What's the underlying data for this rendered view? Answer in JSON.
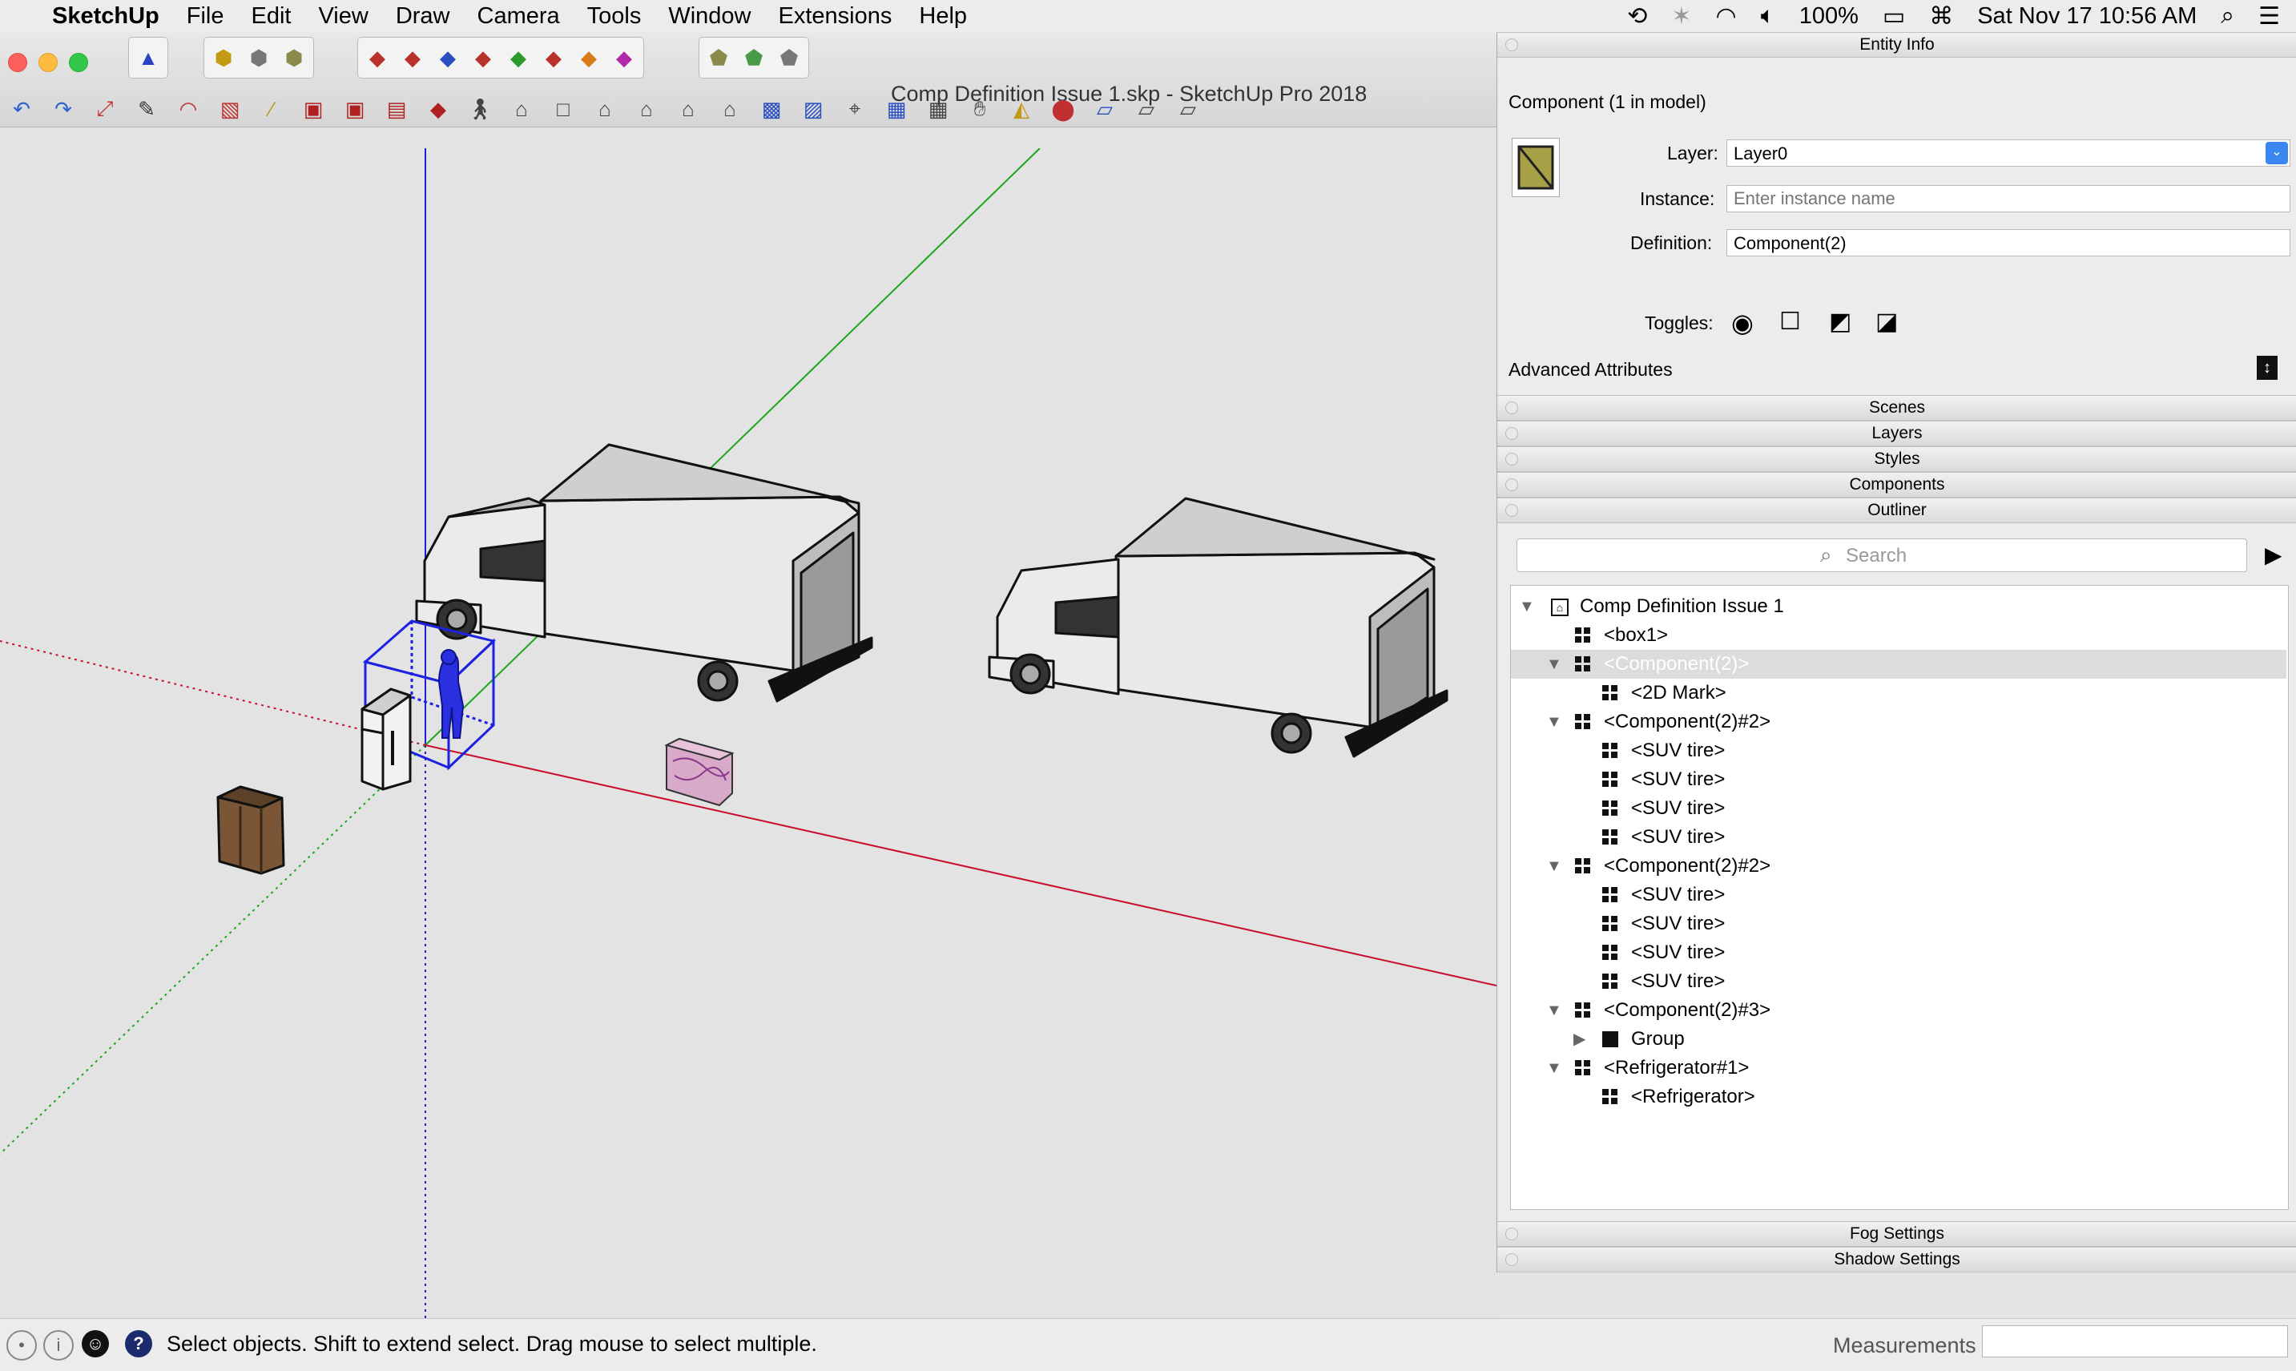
{
  "menubar": {
    "app": "SketchUp",
    "items": [
      "File",
      "Edit",
      "View",
      "Draw",
      "Camera",
      "Tools",
      "Window",
      "Extensions",
      "Help"
    ],
    "battery": "100%",
    "datetime": "Sat Nov 17  10:56 AM"
  },
  "window": {
    "title": "Comp Definition Issue 1.skp - SketchUp Pro 2018"
  },
  "entity_info": {
    "header": "Entity Info",
    "heading": "Component (1 in model)",
    "layer_label": "Layer:",
    "layer_value": "Layer0",
    "instance_label": "Instance:",
    "instance_placeholder": "Enter instance name",
    "definition_label": "Definition:",
    "definition_value": "Component(2)",
    "toggles_label": "Toggles:",
    "advanced_label": "Advanced Attributes"
  },
  "trays": {
    "scenes": "Scenes",
    "layers": "Layers",
    "styles": "Styles",
    "components": "Components",
    "outliner": "Outliner",
    "fog": "Fog Settings",
    "shadow": "Shadow Settings"
  },
  "outliner": {
    "search_placeholder": "Search",
    "rows": [
      {
        "label": "Comp Definition Issue 1",
        "indent": 0,
        "toggle": "open",
        "icon": "model"
      },
      {
        "label": "<box1>",
        "indent": 1,
        "toggle": "none",
        "icon": "component"
      },
      {
        "label": "<Component(2)>",
        "indent": 1,
        "toggle": "open",
        "icon": "component",
        "selected": true
      },
      {
        "label": "<2D Mark>",
        "indent": 2,
        "toggle": "none",
        "icon": "component"
      },
      {
        "label": "<Component(2)#2>",
        "indent": 1,
        "toggle": "open",
        "icon": "component"
      },
      {
        "label": "<SUV tire>",
        "indent": 2,
        "toggle": "none",
        "icon": "component"
      },
      {
        "label": "<SUV tire>",
        "indent": 2,
        "toggle": "none",
        "icon": "component"
      },
      {
        "label": "<SUV tire>",
        "indent": 2,
        "toggle": "none",
        "icon": "component"
      },
      {
        "label": "<SUV tire>",
        "indent": 2,
        "toggle": "none",
        "icon": "component"
      },
      {
        "label": "<Component(2)#2>",
        "indent": 1,
        "toggle": "open",
        "icon": "component"
      },
      {
        "label": "<SUV tire>",
        "indent": 2,
        "toggle": "none",
        "icon": "component"
      },
      {
        "label": "<SUV tire>",
        "indent": 2,
        "toggle": "none",
        "icon": "component"
      },
      {
        "label": "<SUV tire>",
        "indent": 2,
        "toggle": "none",
        "icon": "component"
      },
      {
        "label": "<SUV tire>",
        "indent": 2,
        "toggle": "none",
        "icon": "component"
      },
      {
        "label": "<Component(2)#3>",
        "indent": 1,
        "toggle": "open",
        "icon": "component"
      },
      {
        "label": "Group",
        "indent": 2,
        "toggle": "closed",
        "icon": "group"
      },
      {
        "label": "<Refrigerator#1>",
        "indent": 1,
        "toggle": "open",
        "icon": "component"
      },
      {
        "label": "<Refrigerator>",
        "indent": 2,
        "toggle": "none",
        "icon": "component"
      }
    ]
  },
  "status": {
    "message": "Select objects. Shift to extend select. Drag mouse to select multiple.",
    "measurements_label": "Measurements"
  },
  "colors": {
    "selection": "#1d22e0",
    "axis_red": "#c8102e",
    "axis_green": "#1aa81a",
    "axis_blue": "#1e1ed8"
  }
}
